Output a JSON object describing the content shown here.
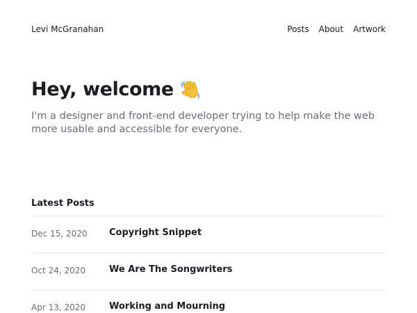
{
  "header": {
    "site_name": "Levi McGranahan",
    "nav": [
      {
        "label": "Posts"
      },
      {
        "label": "About"
      },
      {
        "label": "Artwork"
      }
    ]
  },
  "hero": {
    "title": "Hey, welcome",
    "icon": "waving-hand-icon",
    "subtitle": "I'm a designer and front-end developer trying to help make the web more usable and accessible for everyone."
  },
  "latest_posts": {
    "heading": "Latest Posts",
    "posts": [
      {
        "date": "Dec 15, 2020",
        "title": "Copyright Snippet"
      },
      {
        "date": "Oct 24, 2020",
        "title": "We Are The Songwriters"
      },
      {
        "date": "Apr 13, 2020",
        "title": "Working and Mourning"
      }
    ]
  },
  "colors": {
    "text": "#1c1c22",
    "muted": "#6b6b76",
    "divider": "#ececef",
    "background": "#ffffff",
    "wave": "#f5c33b"
  }
}
